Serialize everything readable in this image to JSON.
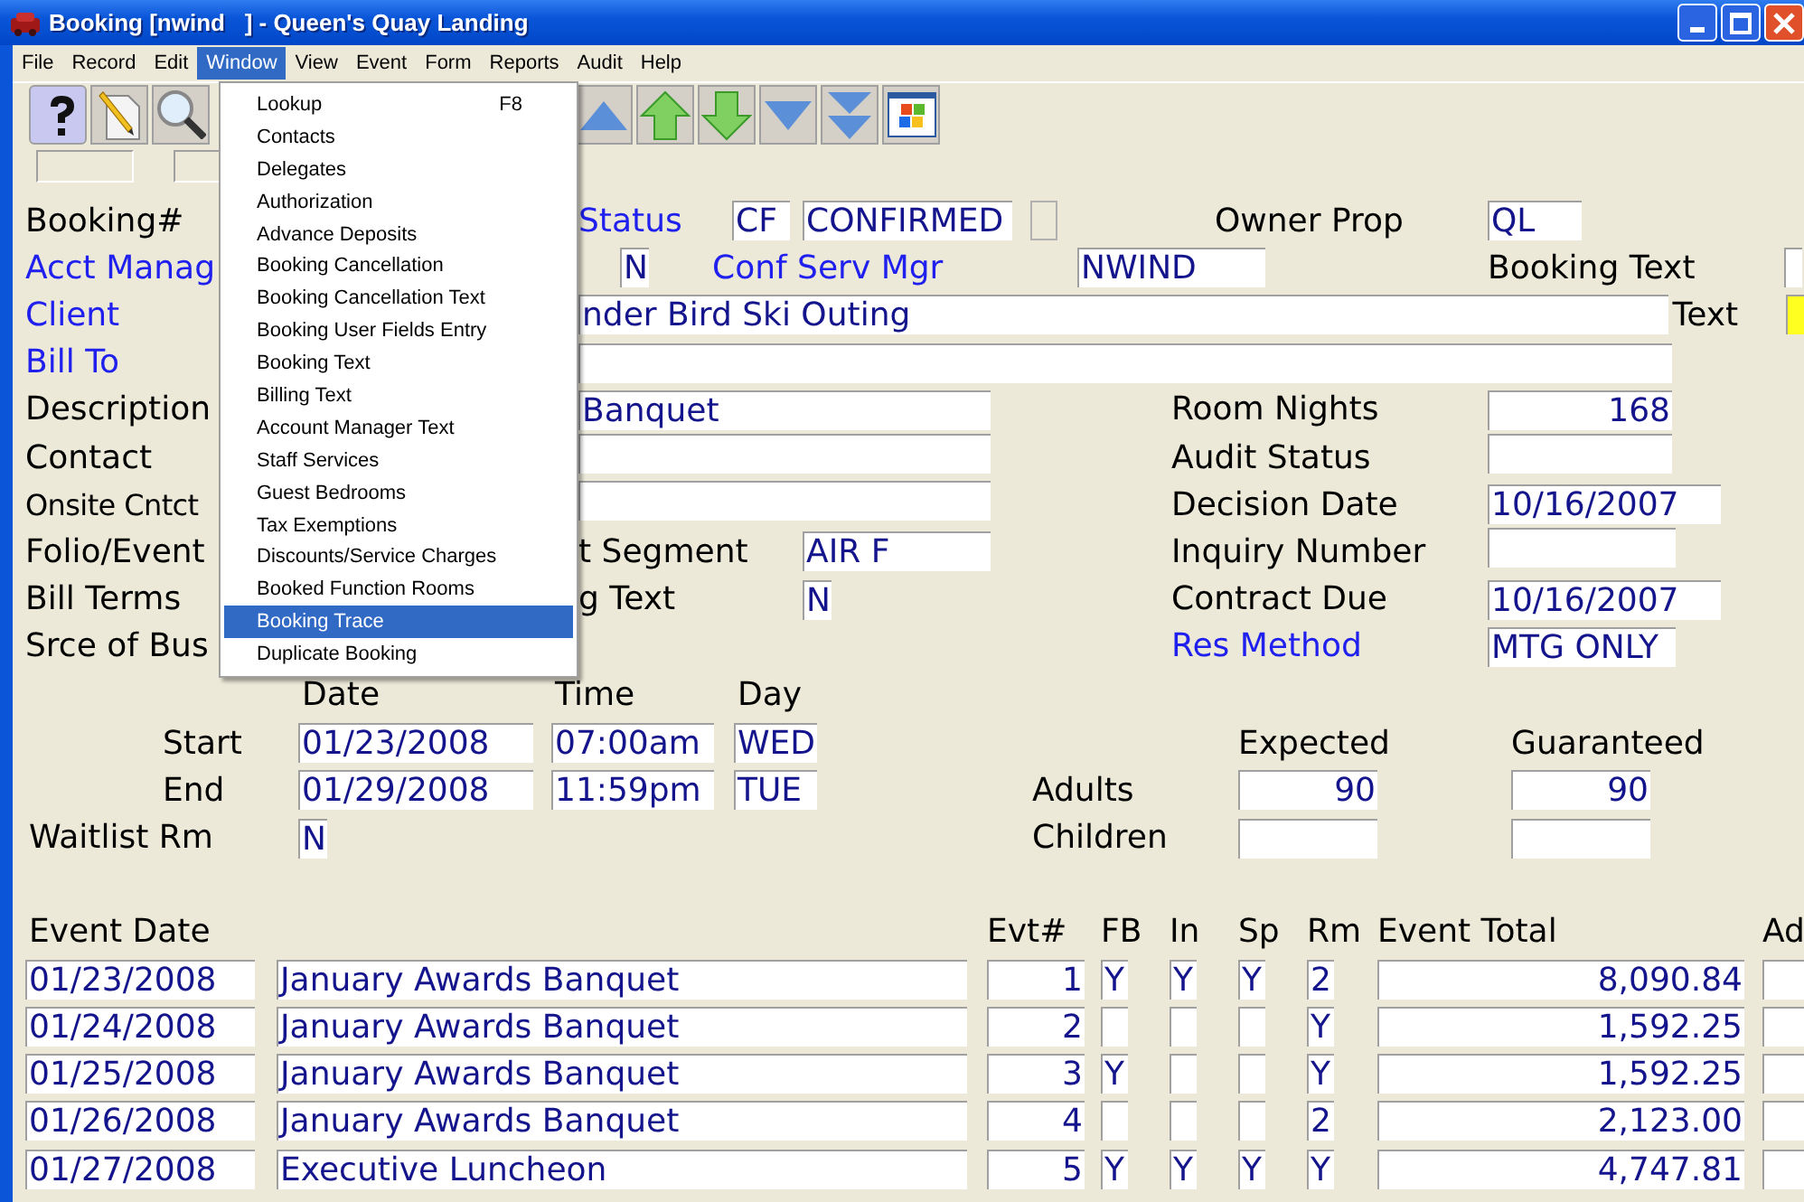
{
  "window": {
    "title": "Booking [nwind   ] - Queen's Quay Landing"
  },
  "menu_bar": [
    {
      "label": "File",
      "selected": false
    },
    {
      "label": "Record",
      "selected": false
    },
    {
      "label": "Edit",
      "selected": false
    },
    {
      "label": "Window",
      "selected": true
    },
    {
      "label": "View",
      "selected": false
    },
    {
      "label": "Event",
      "selected": false
    },
    {
      "label": "Form",
      "selected": false
    },
    {
      "label": "Reports",
      "selected": false
    },
    {
      "label": "Audit",
      "selected": false
    },
    {
      "label": "Help",
      "selected": false
    }
  ],
  "window_menu": [
    {
      "label": "Lookup",
      "shortcut": "F8",
      "selected": false
    },
    {
      "label": "Contacts",
      "selected": false
    },
    {
      "label": "Delegates",
      "selected": false
    },
    {
      "label": "Authorization",
      "selected": false
    },
    {
      "label": "Advance Deposits",
      "selected": false
    },
    {
      "label": "Booking Cancellation",
      "selected": false
    },
    {
      "label": "Booking Cancellation Text",
      "selected": false
    },
    {
      "label": "Booking User Fields Entry",
      "selected": false
    },
    {
      "label": "Booking Text",
      "selected": false
    },
    {
      "label": "Billing Text",
      "selected": false
    },
    {
      "label": "Account Manager Text",
      "selected": false
    },
    {
      "label": "Staff Services",
      "selected": false
    },
    {
      "label": "Guest Bedrooms",
      "selected": false
    },
    {
      "label": "Tax Exemptions",
      "selected": false
    },
    {
      "label": "Discounts/Service Charges",
      "selected": false
    },
    {
      "label": "Booked Function Rooms",
      "selected": false
    },
    {
      "label": "Booking Trace",
      "selected": true
    },
    {
      "label": "Duplicate Booking",
      "selected": false
    }
  ],
  "form": {
    "booking": {
      "label": "Booking#",
      "link": false
    },
    "status": {
      "label": "Status",
      "link": true,
      "code": "CF",
      "value": "CONFIRMED"
    },
    "owner_prop": {
      "label": "Owner Prop",
      "link": false,
      "value": "QL"
    },
    "acct_manager": {
      "label": "Acct Manag",
      "link": true,
      "value": "N"
    },
    "conf_serv_mgr": {
      "label": "Conf Serv Mgr",
      "link": true,
      "value": "NWIND"
    },
    "booking_text": {
      "label": "Booking Text",
      "link": false,
      "highlighted": false
    },
    "client": {
      "label": "Client",
      "link": true,
      "value": "nder Bird Ski Outing"
    },
    "text": {
      "label": "Text",
      "link": false,
      "highlighted": true
    },
    "bill_to": {
      "label": "Bill To",
      "link": true
    },
    "description": {
      "label": "Description",
      "link": false,
      "value": "Banquet"
    },
    "room_nights": {
      "label": "Room Nights",
      "link": false,
      "value": "168"
    },
    "contact": {
      "label": "Contact",
      "link": false
    },
    "audit_status": {
      "label": "Audit Status",
      "link": false
    },
    "onsite_contact": {
      "label": "Onsite Cntct",
      "link": false
    },
    "decision_date": {
      "label": "Decision Date",
      "link": false,
      "value": "10/16/2007"
    },
    "folio_event": {
      "label": "Folio/Event",
      "link": false
    },
    "segment": {
      "label": "t Segment",
      "link": false,
      "value": "AIR F"
    },
    "inquiry_number": {
      "label": "Inquiry Number",
      "link": false
    },
    "bill_terms": {
      "label": "Bill Terms",
      "link": false
    },
    "billing_text": {
      "label": "g Text",
      "link": false,
      "value": "N"
    },
    "contract_due": {
      "label": "Contract Due",
      "link": false,
      "value": "10/16/2007"
    },
    "source": {
      "label": "Srce of Bus",
      "link": false
    },
    "res_method": {
      "label": "Res Method",
      "link": true,
      "value": "MTG ONLY"
    }
  },
  "schedule": {
    "columns": [
      "Date",
      "Time",
      "Day"
    ],
    "rows": [
      {
        "label": "Start",
        "date": "01/23/2008",
        "time": "07:00am",
        "day": "WED"
      },
      {
        "label": "End",
        "date": "01/29/2008",
        "time": "11:59pm",
        "day": "TUE"
      }
    ]
  },
  "waitlist": {
    "label": "Waitlist Rm",
    "value": "N"
  },
  "attendance": {
    "columns": [
      "Expected",
      "Guaranteed"
    ],
    "rows": [
      {
        "label": "Adults",
        "expected": "90",
        "guaranteed": "90"
      },
      {
        "label": "Children",
        "expected": "",
        "guaranteed": ""
      }
    ]
  },
  "events": {
    "columns": [
      "Event Date",
      "Evt#",
      "FB",
      "In",
      "Sp",
      "Rm",
      "Event Total",
      "Ad"
    ],
    "rows": [
      {
        "date": "01/23/2008",
        "name": "January Awards Banquet",
        "evt": "1",
        "fb": "Y",
        "in": "Y",
        "sp": "Y",
        "rm": "2",
        "total": "8,090.84"
      },
      {
        "date": "01/24/2008",
        "name": "January Awards Banquet",
        "evt": "2",
        "fb": "",
        "in": "",
        "sp": "",
        "rm": "Y",
        "total": "1,592.25"
      },
      {
        "date": "01/25/2008",
        "name": "January Awards Banquet",
        "evt": "3",
        "fb": "Y",
        "in": "",
        "sp": "",
        "rm": "Y",
        "total": "1,592.25"
      },
      {
        "date": "01/26/2008",
        "name": "January Awards Banquet",
        "evt": "4",
        "fb": "",
        "in": "",
        "sp": "",
        "rm": "2",
        "total": "2,123.00"
      },
      {
        "date": "01/27/2008",
        "name": "Executive Luncheon",
        "evt": "5",
        "fb": "Y",
        "in": "Y",
        "sp": "Y",
        "rm": "Y",
        "total": "4,747.81"
      }
    ]
  }
}
